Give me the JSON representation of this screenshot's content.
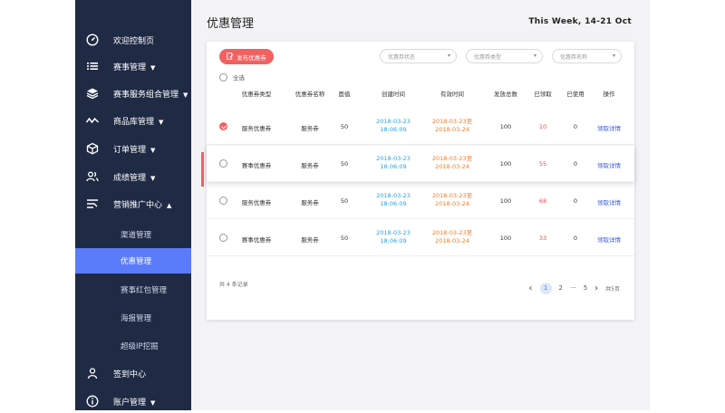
{
  "sidebar": {
    "items": [
      {
        "label": "欢迎控制页",
        "icon": "dashboard-icon",
        "caret": ""
      },
      {
        "label": "赛事管理",
        "icon": "list-icon",
        "caret": "▼"
      },
      {
        "label": "赛事服务组合管理",
        "icon": "layers-icon",
        "caret": "▼"
      },
      {
        "label": "商品库管理",
        "icon": "pulse-icon",
        "caret": "▼"
      },
      {
        "label": "订单管理",
        "icon": "box-icon",
        "caret": "▼"
      },
      {
        "label": "成绩管理",
        "icon": "users-icon",
        "caret": "▼"
      },
      {
        "label": "营销推广中心",
        "icon": "marketing-icon",
        "caret": "▲"
      }
    ],
    "sub_items": [
      {
        "label": "渠道管理"
      },
      {
        "label": "优惠管理",
        "active": true
      },
      {
        "label": "赛事红包管理"
      },
      {
        "label": "海报管理"
      },
      {
        "label": "超级IP挖掘"
      }
    ],
    "bottom_items": [
      {
        "label": "签到中心",
        "icon": "person-icon",
        "caret": ""
      },
      {
        "label": "账户管理",
        "icon": "info-icon",
        "caret": "▼"
      }
    ]
  },
  "header": {
    "title": "优惠管理",
    "week": "This Week, 14-21 Oct"
  },
  "toolbar": {
    "publish_label": "发布优惠券",
    "filters": [
      "优惠券状态",
      "优惠券类型",
      "优惠券名称"
    ],
    "select_all": "全选"
  },
  "table": {
    "columns": [
      "优惠券类型",
      "优惠券名称",
      "面值",
      "创建时间",
      "有效时间",
      "发放总数",
      "已领取",
      "已使用",
      "操作"
    ],
    "rows": [
      {
        "type": "服务优惠券",
        "name": "服务券",
        "value": "50",
        "created": [
          "2018-03-23",
          "18:06:09"
        ],
        "valid": [
          "2018-03-23至",
          "2018-03-24"
        ],
        "total": "100",
        "claimed": "10",
        "used": "0",
        "action": "领取详情",
        "checked": true
      },
      {
        "type": "赛事优惠券",
        "name": "服务券",
        "value": "50",
        "created": [
          "2018-03-23",
          "18:06:09"
        ],
        "valid": [
          "2018-03-23至",
          "2018-03-24"
        ],
        "total": "100",
        "claimed": "55",
        "used": "0",
        "action": "领取详情",
        "checked": false
      },
      {
        "type": "服务优惠券",
        "name": "服务券",
        "value": "50",
        "created": [
          "2018-03-23",
          "18:06:09"
        ],
        "valid": [
          "2018-03-23至",
          "2018-03-24"
        ],
        "total": "100",
        "claimed": "68",
        "used": "0",
        "action": "领取详情",
        "checked": false
      },
      {
        "type": "赛事优惠券",
        "name": "服务券",
        "value": "50",
        "created": [
          "2018-03-23",
          "18:06:09"
        ],
        "valid": [
          "2018-03-23至",
          "2018-03-24"
        ],
        "total": "100",
        "claimed": "33",
        "used": "0",
        "action": "领取详情",
        "checked": false
      }
    ]
  },
  "footer": {
    "record_count": "共 4 条记录",
    "pages": [
      "1",
      "2",
      "···",
      "5"
    ],
    "current_page": "1",
    "total_pages": "共5页"
  },
  "colors": {
    "sidebar_bg": "#1f2a44",
    "accent": "#5b7cfa",
    "brand_red": "#f26060"
  }
}
